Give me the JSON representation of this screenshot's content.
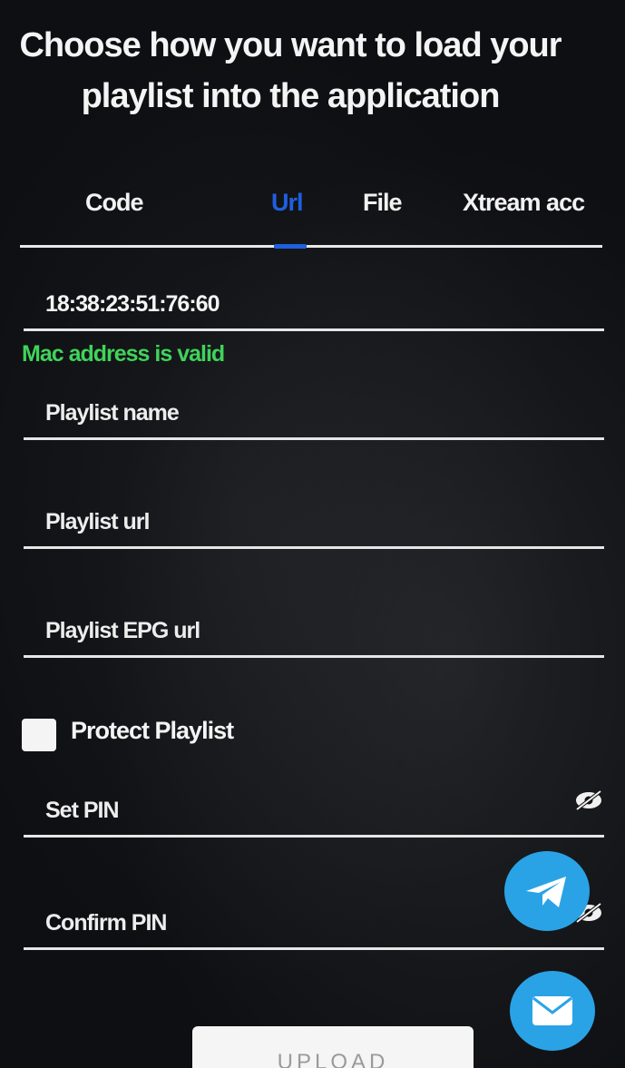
{
  "header": {
    "title": "Choose how you want to load your playlist into the application"
  },
  "tabs": [
    {
      "label": "Code"
    },
    {
      "label": "Url"
    },
    {
      "label": "File"
    },
    {
      "label": "Xtream acc"
    }
  ],
  "active_tab": "Url",
  "form": {
    "mac_address": "18:38:23:51:76:60",
    "mac_status": "Mac address is valid",
    "playlist_name_placeholder": "Playlist name",
    "playlist_url_placeholder": "Playlist url",
    "playlist_epg_placeholder": "Playlist EPG url",
    "protect_label": "Protect Playlist",
    "protect_checked": false,
    "set_pin_placeholder": "Set PIN",
    "confirm_pin_placeholder": "Confirm PIN",
    "upload_label": "UPLOAD"
  },
  "icons": {
    "telegram": "telegram-icon",
    "mail": "mail-icon",
    "eye_hidden": "eye-off-icon"
  },
  "colors": {
    "accent_blue": "#1f5fe0",
    "valid_green": "#3fd35a",
    "fab_blue": "#2aa3e6",
    "background": "#0e0f12"
  }
}
